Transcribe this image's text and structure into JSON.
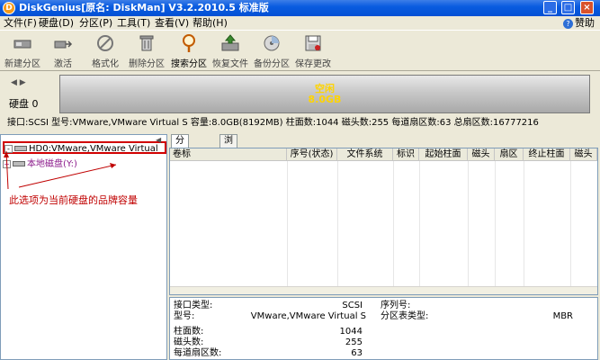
{
  "window": {
    "title": "DiskGenius[原名: DiskMan] V3.2.2010.5 标准版",
    "app_icon": "disk-genius-icon",
    "controls": [
      "_",
      "□",
      "×"
    ]
  },
  "menu": {
    "items": [
      "文件(F)",
      "硬盘(D)",
      "分区(P)",
      "工具(T)",
      "查看(V)",
      "帮助(H)"
    ],
    "help_link": "赞助"
  },
  "toolbar": {
    "buttons": [
      {
        "label": "新建分区",
        "icon": "new-partition-icon"
      },
      {
        "label": "激活",
        "icon": "activate-icon"
      },
      {
        "label": "格式化",
        "icon": "format-icon"
      },
      {
        "label": "删除分区",
        "icon": "delete-partition-icon"
      },
      {
        "label": "搜索分区",
        "icon": "search-partition-icon"
      },
      {
        "label": "恢复文件",
        "icon": "recover-files-icon"
      },
      {
        "label": "备份分区",
        "icon": "backup-partition-icon"
      },
      {
        "label": "保存更改",
        "icon": "save-changes-icon"
      }
    ]
  },
  "disk_map": {
    "disk_label": "硬盘 0",
    "partition": {
      "label": "空闲",
      "size": "8.0GB"
    }
  },
  "disk_info": {
    "text": "接口:SCSI  型号:VMware,VMware Virtual S  容量:8.0GB(8192MB)  柱面数:1044  磁头数:255  每道扇区数:63  总扇区数:16777216"
  },
  "tree": {
    "selected_item": "HD0:VMware,VMware Virtual",
    "local_disk_item": "本地磁盘(Y:)",
    "annotation": "此选项为当前硬盘的品牌容量"
  },
  "tabs": [
    "分区参数",
    "浏览文件"
  ],
  "partition_table": {
    "columns": [
      "卷标",
      "序号(状态)",
      "文件系统",
      "标识",
      "起始柱面",
      "磁头",
      "扇区",
      "终止柱面",
      "磁头"
    ]
  },
  "details": {
    "rows": [
      {
        "key": "接口类型:",
        "value": "SCSI",
        "key2": "序列号:",
        "value2": ""
      },
      {
        "key": "型号:",
        "value": "VMware,VMware Virtual S",
        "key2": "分区表类型:",
        "value2": "MBR"
      },
      {
        "key": "柱面数:",
        "value": "1044"
      },
      {
        "key": "磁头数:",
        "value": "255"
      },
      {
        "key": "每道扇区数:",
        "value": "63"
      }
    ]
  }
}
